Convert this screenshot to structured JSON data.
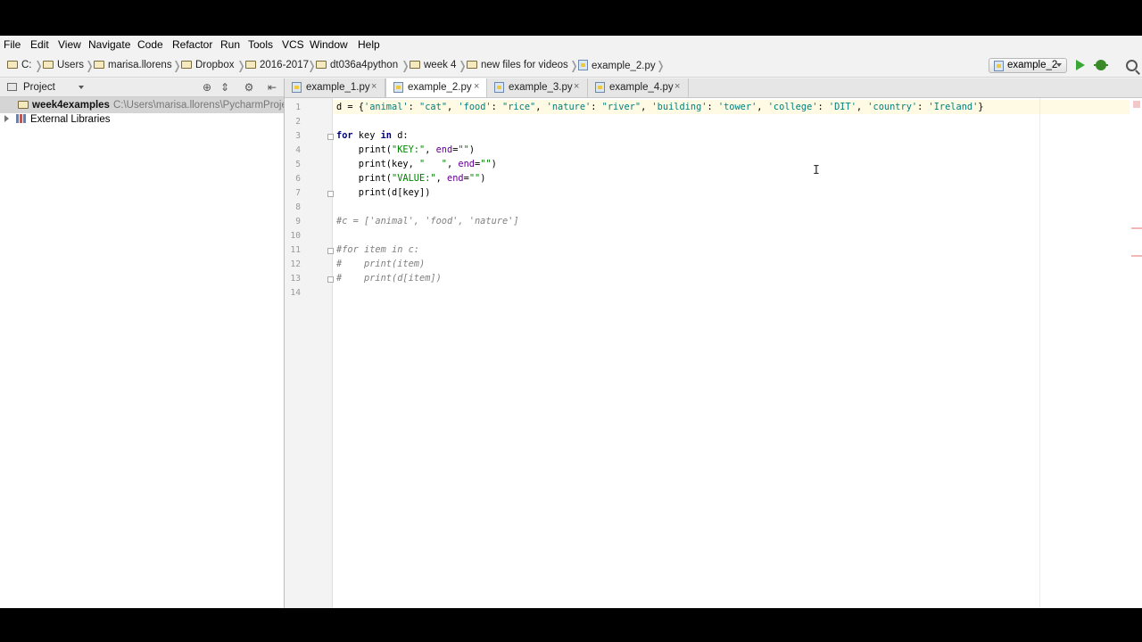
{
  "menu": [
    "File",
    "Edit",
    "View",
    "Navigate",
    "Code",
    "Refactor",
    "Run",
    "Tools",
    "VCS",
    "Window",
    "Help"
  ],
  "breadcrumbs": [
    "C:",
    "Users",
    "marisa.llorens",
    "Dropbox",
    "2016-2017",
    "dt036a4python",
    "week 4",
    "new files for videos",
    "example_2.py"
  ],
  "run_config": "example_2",
  "project_panel": {
    "title": "Project",
    "root": "week4examples",
    "root_path": "C:\\Users\\marisa.llorens\\PycharmProjects",
    "libraries": "External Libraries"
  },
  "tabs": [
    {
      "label": "example_1.py",
      "active": false
    },
    {
      "label": "example_2.py",
      "active": true
    },
    {
      "label": "example_3.py",
      "active": false
    },
    {
      "label": "example_4.py",
      "active": false
    }
  ],
  "line_numbers": [
    "1",
    "2",
    "3",
    "4",
    "5",
    "6",
    "7",
    "8",
    "9",
    "10",
    "11",
    "12",
    "13",
    "14"
  ],
  "code": {
    "l1": {
      "a": "d = {",
      "b": "'animal'",
      ":1": ": ",
      "c": "\"cat\"",
      "d": ", ",
      "e": "'food'",
      "f": ": ",
      "g": "\"rice\"",
      "h": ", ",
      "i": "'nature'",
      "j": ": ",
      "k": "\"river\"",
      "l": ", ",
      "m": "'building'",
      "n": ": ",
      "o": "'tower'",
      "p": ", ",
      "q": "'college'",
      "r": ": ",
      "s": "'DIT'",
      "t": ", ",
      "u": "'country'",
      "v": ": ",
      "w": "'Ireland'",
      "x": "}"
    },
    "l3": {
      "kw1": "for",
      "a": " key ",
      "kw2": "in",
      "b": " d:"
    },
    "l4": {
      "a": "    print(",
      "s": "\"KEY:\"",
      "b": ", ",
      "k": "end",
      "c": "=",
      "s2": "\"\"",
      "d": ")"
    },
    "l5": {
      "a": "    print(key, ",
      "s": "\"   \"",
      "b": ", ",
      "k": "end",
      "c": "=",
      "s2": "\"\"",
      "d": ")"
    },
    "l6": {
      "a": "    print(",
      "s": "\"VALUE:\"",
      "b": ", ",
      "k": "end",
      "c": "=",
      "s2": "\"\"",
      "d": ")"
    },
    "l7": "    print(d[key])",
    "l9": "#c = ['animal', 'food', 'nature']",
    "l11": "#for item in c:",
    "l12": "#    print(item)",
    "l13": "#    print(d[item])"
  },
  "icons": {
    "close": "×",
    "separator": "❭",
    "ibeam": "I"
  }
}
